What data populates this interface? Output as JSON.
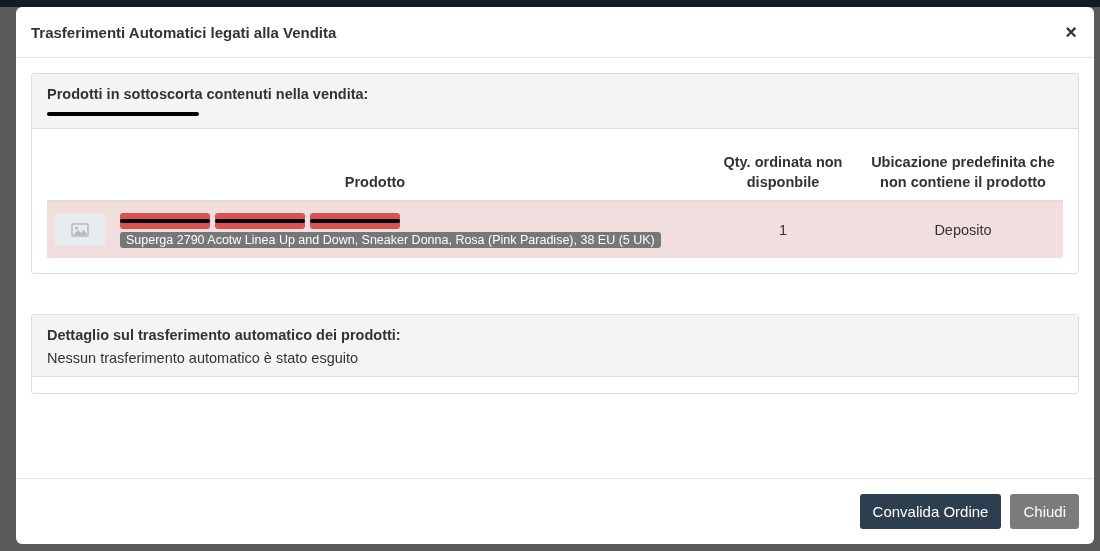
{
  "modal": {
    "title": "Trasferimenti Automatici legati alla Vendita",
    "close": "×"
  },
  "panel_products": {
    "heading": "Prodotti in sottoscorta contenuti nella vendita:",
    "order_number": {
      "kind": "redacted"
    },
    "columns": [
      "Prodotto",
      "Qty. ordinata non disponbile",
      "Ubicazione predefinita che non contiene il prodotto"
    ],
    "rows": [
      {
        "tags": [
          {
            "kind": "redacted"
          },
          {
            "kind": "redacted"
          },
          {
            "kind": "redacted"
          }
        ],
        "name": "Superga 2790 Acotw Linea Up and Down, Sneaker Donna, Rosa (Pink Paradise), 38 EU (5 UK)",
        "qty": "1",
        "location": "Deposito",
        "kind": "missing"
      }
    ]
  },
  "panel_transfers": {
    "heading": "Dettaglio sul trasferimento automatico dei prodotti:",
    "message": "Nessun trasferimento automatico è stato esguito"
  },
  "buttons": [
    {
      "label": "Convalida Ordine",
      "kind": "primary"
    },
    {
      "label": "Chiudi",
      "kind": "secondary"
    }
  ]
}
